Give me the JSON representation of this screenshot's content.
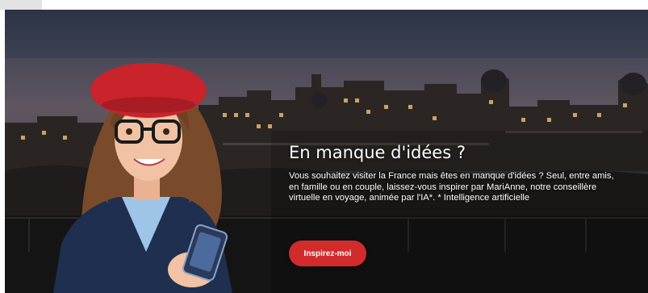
{
  "hero": {
    "title": "En manque d'idées ?",
    "description": "Vous souhaitez visiter la France mais êtes en manque d'idées ? Seul, entre amis, en famille ou en couple, laissez-vous inspirer par MariAnne, notre conseillère virtuelle en voyage, animée par l'IA*. * Intelligence artificielle",
    "cta_label": "Inspirez-moi"
  },
  "colors": {
    "accent": "#d22b2b",
    "beret": "#c9232b",
    "sky": "#3f4556"
  },
  "icons": [
    "smartphone-icon"
  ]
}
